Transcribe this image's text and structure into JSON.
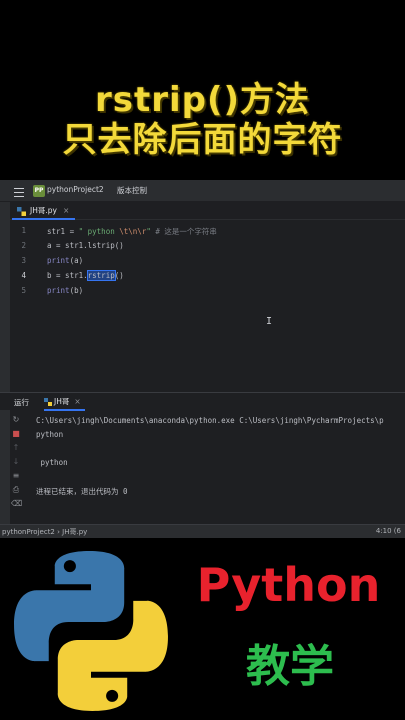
{
  "title": {
    "line1": "rstrip()方法",
    "line2": "只去除后面的字符"
  },
  "ide": {
    "project_badge": "PP",
    "project_name": "pythonProject2",
    "vcs_label": "版本控制",
    "file_tab": "JH哥.py",
    "line_numbers": [
      "1",
      "2",
      "3",
      "4",
      "5"
    ],
    "code": {
      "line1_pre": "str1 = ",
      "line1_str": "\" python ",
      "line1_esc": "\\t\\n\\r",
      "line1_strend": "\" ",
      "line1_comment": "# 这是一个字符串",
      "line2_pre": "a = str1.",
      "line2_fn": "lstrip",
      "line2_post": "()",
      "line3_bi": "print",
      "line3_post": "(a)",
      "line4_pre": "b = str1.",
      "line4_sel": "rstrip",
      "line4_post": "()",
      "line5_bi": "print",
      "line5_post": "(b)"
    },
    "run_label": "运行",
    "run_tab": "JH哥",
    "console_lines": [
      "C:\\Users\\jingh\\Documents\\anaconda\\python.exe C:\\Users\\jingh\\PycharmProjects\\p",
      "python",
      "",
      " python",
      "",
      "进程已结束，退出代码为 0"
    ],
    "status_path": "pythonProject2 › JH哥.py",
    "status_pos": "4:10 (6"
  },
  "brand": {
    "word": "Python",
    "sub": "教学",
    "colors": {
      "logo_blue": "#3a76ab",
      "logo_yellow": "#f3cf3a",
      "word": "#e8222d",
      "sub": "#2dbd4e"
    }
  },
  "accent_color": "#f3d93a"
}
